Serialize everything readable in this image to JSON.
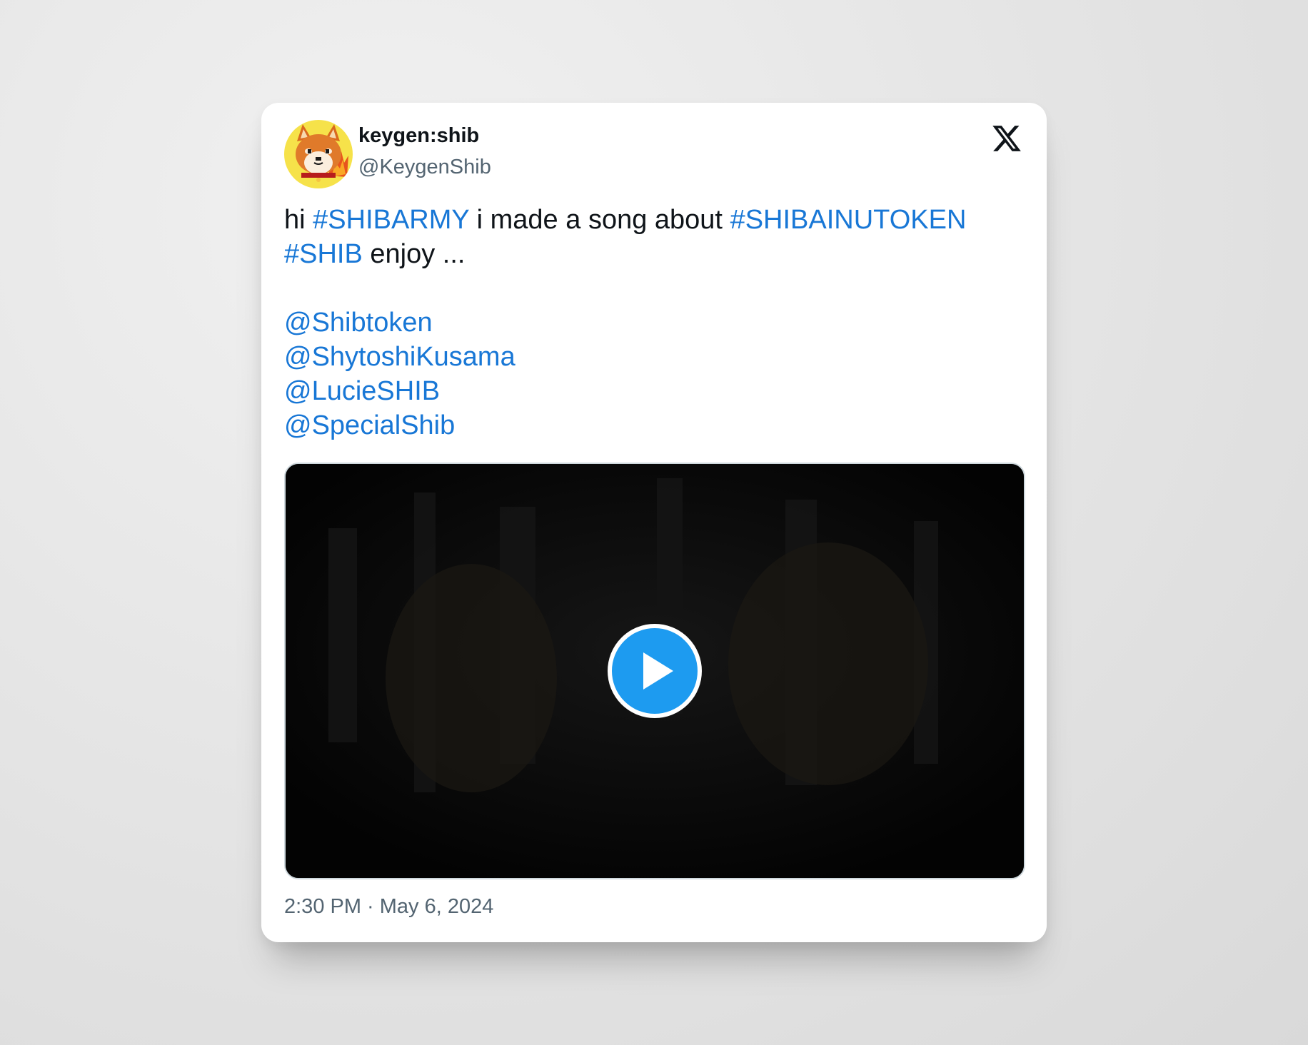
{
  "author": {
    "display_name": "keygen:shib",
    "handle": "@KeygenShib",
    "avatar_icon": "shiba-inu-avatar-icon"
  },
  "platform_logo": "x-logo-icon",
  "tweet": {
    "line1": {
      "t1": "hi ",
      "tag1": "#SHIBARMY",
      "t2": " i made a song about ",
      "tag2": "#SHIBAINUTOKEN"
    },
    "line2": {
      "tag3": "#SHIB",
      "t3": " enjoy ..."
    },
    "mentions": [
      "@Shibtoken",
      "@ShytoshiKusama",
      "@LucieSHIB",
      "@SpecialShib"
    ]
  },
  "media": {
    "type": "video",
    "play_icon": "play-icon"
  },
  "timestamp": "2:30 PM · May 6, 2024",
  "colors": {
    "link": "#1877d6",
    "play_button": "#1d9bf0",
    "text": "#0f1419",
    "muted": "#536471"
  }
}
